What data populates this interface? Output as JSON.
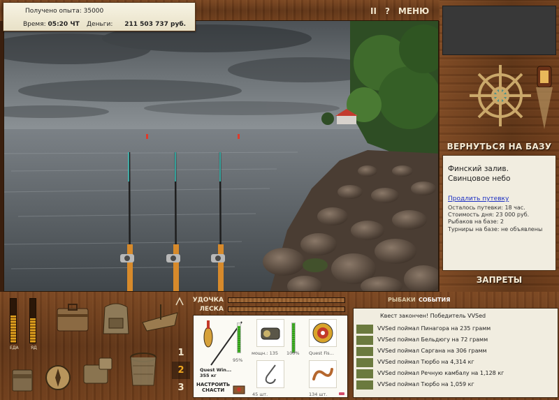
{
  "info": {
    "experience_label": "Получено опыта:",
    "experience_value": "35000",
    "time_label": "Время:",
    "time_value": "05:20 ЧТ",
    "money_label": "Деньги:",
    "money_value": "211 503 737 руб."
  },
  "top_controls": {
    "pause": "II",
    "help": "?",
    "menu": "МЕНЮ"
  },
  "right_panel": {
    "back_to_base": "ВЕРНУТЬСЯ НА БАЗУ",
    "location_line1": "Финский залив.",
    "location_line2": "Свинцовое небо",
    "extend_link": "Продлить путевку",
    "stats": [
      "Осталось путевки: 18 час.",
      "Стоимость дня: 23 000 руб.",
      "Рыбаков на базе: 2",
      "Турниры на базе: не объявлены"
    ],
    "bans": "ЗАПРЕТЫ"
  },
  "meters": {
    "food_label": "ЕДА",
    "poison_label": "ЯД",
    "food_level": 0.62,
    "poison_level": 0.55
  },
  "rod_tabs": [
    "1",
    "2",
    "3"
  ],
  "active_rod_tab": 1,
  "bars": {
    "rod_label": "УДОЧКА",
    "line_label": "ЛЕСКА",
    "rod_fill": 1.0,
    "line_fill": 1.0
  },
  "tackle": {
    "rod_name": "Quest Win...",
    "rod_weight": "355 кг",
    "rod_percent": "95%",
    "reel_power": "мощн.: 135",
    "reel_percent": "100%",
    "line_name": "Quest Fis...",
    "hooks_count": "45 шт.",
    "bait_count": "134 шт.",
    "setup_line1": "НАСТРОИТЬ",
    "setup_line2": "СНАСТИ",
    "rod_gauge": 0.9,
    "reel_gauge": 1.0
  },
  "events_tabs": {
    "fishermen": "РЫБАКИ",
    "events": "СОБЫТИЯ"
  },
  "events": {
    "quest": "Квест закончен! Победитель VVSed",
    "catches": [
      "VVSed поймал Пинагора на 235 грамм",
      "VVSed поймал Бельдюгу на 72 грамм",
      "VVSed поймал Саргана на 306 грамм",
      "VVSed поймал Тюрбо на 4,314 кг",
      "VVSed поймал Речную камбалу на 1,128 кг",
      "VVSed поймал Тюрбо на 1,059 кг"
    ]
  },
  "colors": {
    "wood": "#6b3d1c",
    "panel": "#f1ede0",
    "accent": "#f0a820",
    "link": "#1a2ec2"
  }
}
